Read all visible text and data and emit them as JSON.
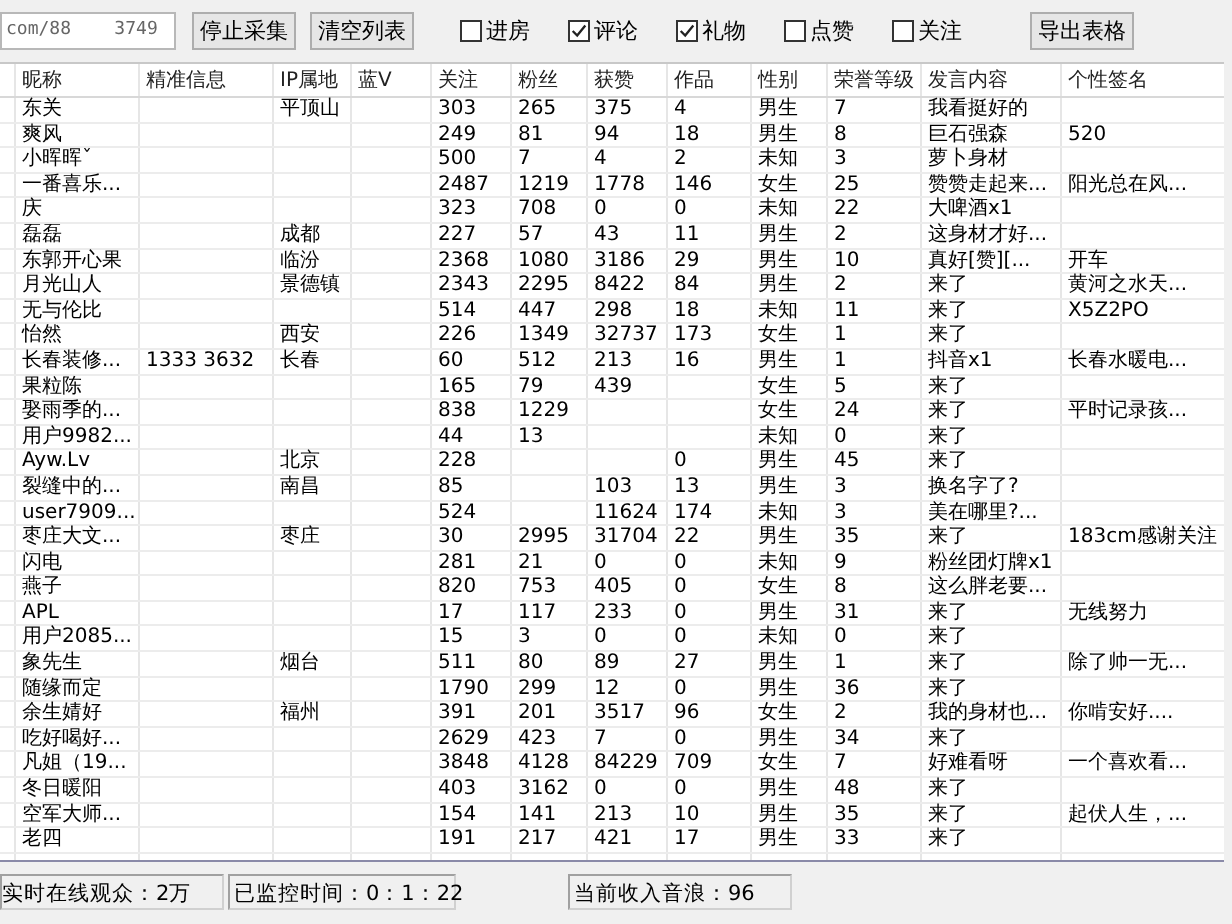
{
  "toolbar": {
    "url": "com/88    3749",
    "buttons": [
      "停止采集",
      "清空列表"
    ],
    "filters": [
      {
        "label": "进房",
        "checked": false
      },
      {
        "label": "评论",
        "checked": true
      },
      {
        "label": "礼物",
        "checked": true
      },
      {
        "label": "点赞",
        "checked": false
      },
      {
        "label": "关注",
        "checked": false
      }
    ],
    "export_button": "导出表格"
  },
  "table": {
    "columns": [
      "昵称",
      "精准信息",
      "IP属地",
      "蓝V",
      "关注",
      "粉丝",
      "获赞",
      "作品",
      "性别",
      "荣誉等级",
      "发言内容",
      "个性签名"
    ],
    "rows": [
      [
        "东关",
        null,
        "平顶山",
        null,
        "303",
        "265",
        "375",
        "4",
        "男生",
        "7",
        "我看挺好的",
        null
      ],
      [
        "爽风",
        null,
        null,
        null,
        "249",
        "81",
        "94",
        "18",
        "男生",
        "8",
        "巨石强森",
        "520"
      ],
      [
        "小晖晖ˇ",
        null,
        null,
        null,
        "500",
        "7",
        "4",
        "2",
        "未知",
        "3",
        "萝卜身材",
        null
      ],
      [
        "一番喜乐...",
        null,
        null,
        null,
        "2487",
        "1219",
        "1778",
        "146",
        "女生",
        "25",
        "赞赞走起来...",
        "阳光总在风..."
      ],
      [
        "庆",
        null,
        null,
        null,
        "323",
        "708",
        "0",
        "0",
        "未知",
        "22",
        "大啤酒x1",
        null
      ],
      [
        "磊磊",
        null,
        "成都",
        null,
        "227",
        "57",
        "43",
        "11",
        "男生",
        "2",
        "这身材才好...",
        null
      ],
      [
        "东郭开心果",
        null,
        "临汾",
        null,
        "2368",
        "1080",
        "3186",
        "29",
        "男生",
        "10",
        "真好[赞][...",
        "开车"
      ],
      [
        "月光山人",
        null,
        "景德镇",
        null,
        "2343",
        "2295",
        "8422",
        "84",
        "男生",
        "2",
        "来了",
        "黄河之水天..."
      ],
      [
        "无与伦比",
        null,
        null,
        null,
        "514",
        "447",
        "298",
        "18",
        "未知",
        "11",
        "来了",
        "X5Z2PO"
      ],
      [
        "怡然",
        null,
        "西安",
        null,
        "226",
        "1349",
        "32737",
        "173",
        "女生",
        "1",
        "来了",
        null
      ],
      [
        "长春装修...",
        "1333    3632",
        "长春",
        null,
        "60",
        "512",
        "213",
        "16",
        "男生",
        "1",
        "抖音x1",
        "长春水暖电..."
      ],
      [
        "果粒陈",
        null,
        null,
        null,
        "165",
        "79",
        "439",
        null,
        "女生",
        "5",
        "来了",
        null
      ],
      [
        "娶雨季的...",
        null,
        null,
        null,
        "838",
        "1229",
        null,
        null,
        "女生",
        "24",
        "来了",
        "平时记录孩..."
      ],
      [
        "用户9982...",
        null,
        null,
        null,
        "44",
        "13",
        null,
        null,
        "未知",
        "0",
        "来了",
        null
      ],
      [
        "Ayw.Lv",
        null,
        "北京",
        null,
        "228",
        null,
        null,
        "0",
        "男生",
        "45",
        "来了",
        null
      ],
      [
        "裂缝中的...",
        null,
        "南昌",
        null,
        "85",
        null,
        "103",
        "13",
        "男生",
        "3",
        "换名字了?",
        null
      ],
      [
        "user7909...",
        null,
        null,
        null,
        "524",
        null,
        "11624",
        "174",
        "未知",
        "3",
        "美在哪里?...",
        null
      ],
      [
        "枣庄大文...",
        null,
        "枣庄",
        null,
        "30",
        "2995",
        "31704",
        "22",
        "男生",
        "35",
        "来了",
        "183cm感谢关注"
      ],
      [
        "闪电",
        null,
        null,
        null,
        "281",
        "21",
        "0",
        "0",
        "未知",
        "9",
        "粉丝团灯牌x1",
        null
      ],
      [
        "燕子",
        null,
        null,
        null,
        "820",
        "753",
        "405",
        "0",
        "女生",
        "8",
        "这么胖老要...",
        null
      ],
      [
        "APL",
        null,
        null,
        null,
        "17",
        "117",
        "233",
        "0",
        "男生",
        "31",
        "来了",
        "无线努力"
      ],
      [
        "用户2085...",
        null,
        null,
        null,
        "15",
        "3",
        "0",
        "0",
        "未知",
        "0",
        "来了",
        null
      ],
      [
        "象先生",
        null,
        "烟台",
        null,
        "511",
        "80",
        "89",
        "27",
        "男生",
        "1",
        "来了",
        "除了帅一无..."
      ],
      [
        "随缘而定",
        null,
        null,
        null,
        "1790",
        "299",
        "12",
        "0",
        "男生",
        "36",
        "来了",
        null
      ],
      [
        "余生婧好",
        null,
        "福州",
        null,
        "391",
        "201",
        "3517",
        "96",
        "女生",
        "2",
        "我的身材也...",
        "你啃安好...."
      ],
      [
        "吃好喝好...",
        null,
        null,
        null,
        "2629",
        "423",
        "7",
        "0",
        "男生",
        "34",
        "来了",
        null
      ],
      [
        "凡姐（19...",
        null,
        null,
        null,
        "3848",
        "4128",
        "84229",
        "709",
        "女生",
        "7",
        "好难看呀",
        "一个喜欢看..."
      ],
      [
        "冬日暖阳",
        null,
        null,
        null,
        "403",
        "3162",
        "0",
        "0",
        "男生",
        "48",
        "来了",
        null
      ],
      [
        "空军大师...",
        null,
        null,
        null,
        "154",
        "141",
        "213",
        "10",
        "男生",
        "35",
        "来了",
        "起伏人生，..."
      ],
      [
        "老四",
        null,
        null,
        null,
        "191",
        "217",
        "421",
        "17",
        "男生",
        "33",
        "来了",
        null
      ]
    ]
  },
  "status_bar": [
    "实时在线观众：2万",
    "已监控时间：0：1：22",
    "当前收入音浪：96"
  ]
}
